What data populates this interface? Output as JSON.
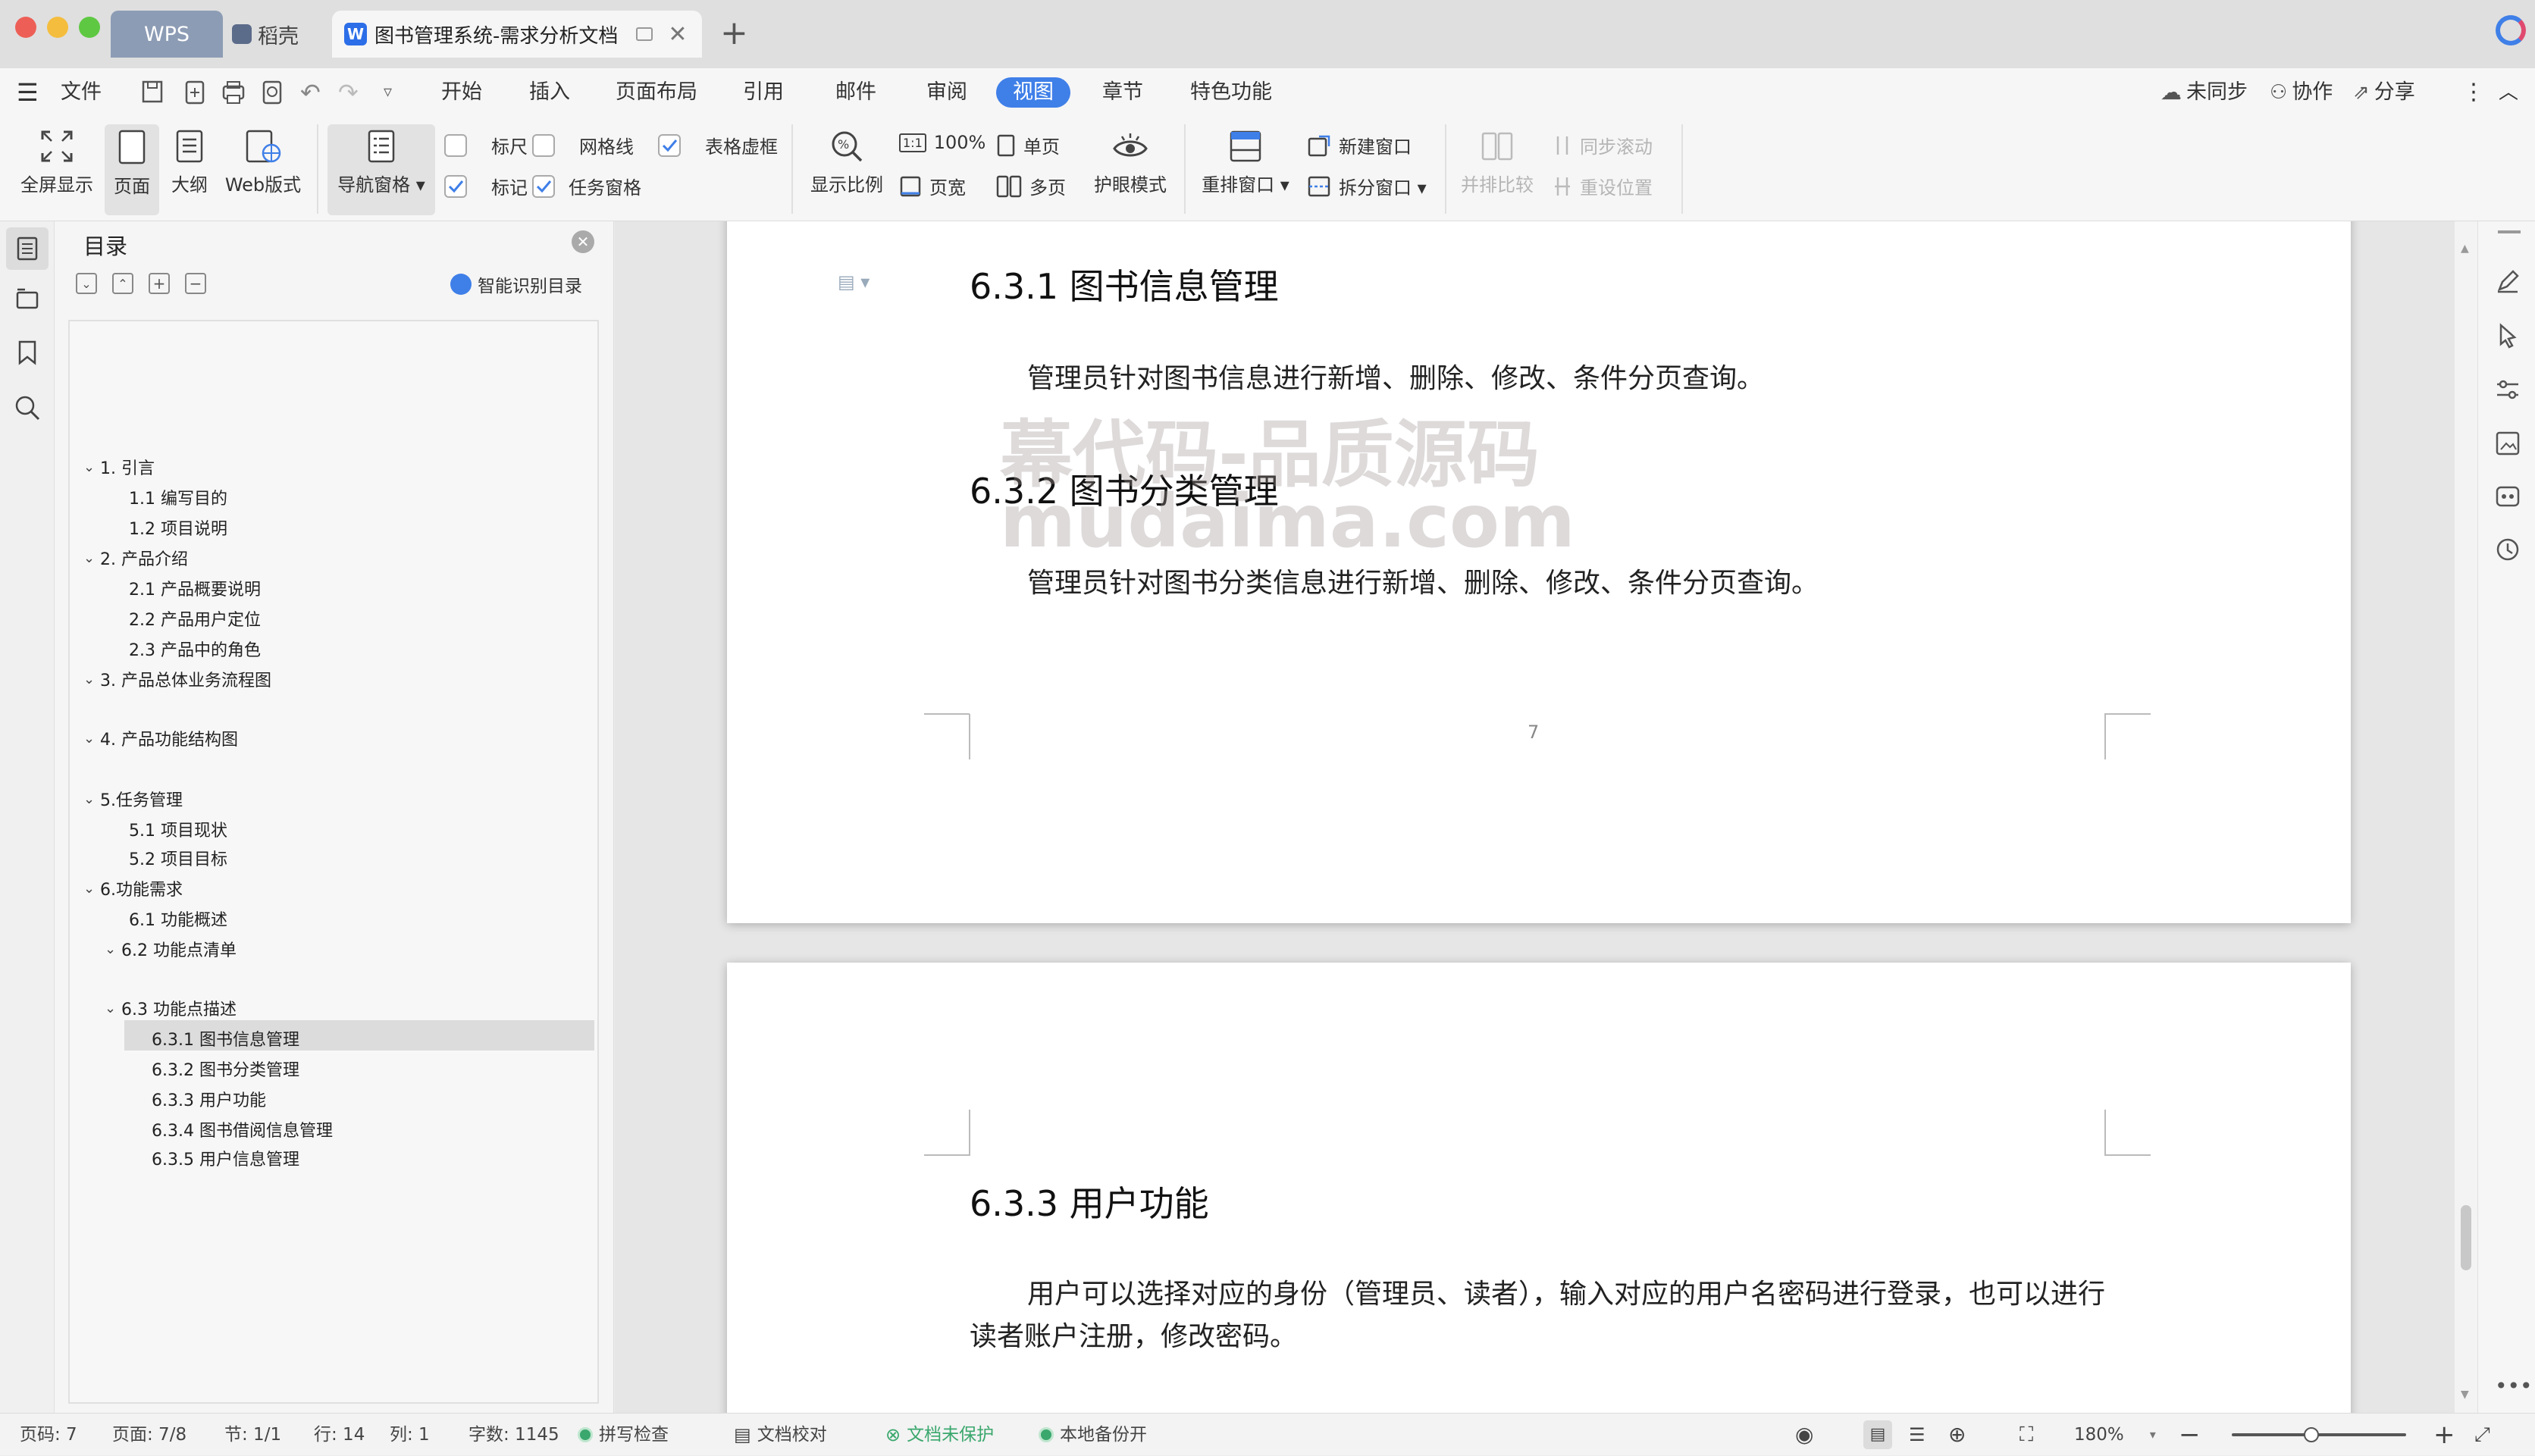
{
  "titlebar": {
    "tabs": [
      {
        "label": "WPS"
      },
      {
        "label": "稻壳"
      },
      {
        "label": "图书管理系统-需求分析文档"
      }
    ]
  },
  "menu": {
    "file": "文件",
    "items": [
      "开始",
      "插入",
      "页面布局",
      "引用",
      "邮件",
      "审阅",
      "视图",
      "章节",
      "特色功能"
    ],
    "active": "视图",
    "right": {
      "sync": "未同步",
      "collab": "协作",
      "share": "分享"
    }
  },
  "toolbar": {
    "fullscreen": "全屏显示",
    "page": "页面",
    "outline": "大纲",
    "web": "Web版式",
    "nav_pane": "导航窗格",
    "ruler": "标尺",
    "gridlines": "网格线",
    "table_frame": "表格虚框",
    "mark": "标记",
    "task_pane": "任务窗格",
    "zoom": "显示比例",
    "zoom100": "100%",
    "page_width": "页宽",
    "single_page": "单页",
    "multi_page": "多页",
    "eye_mode": "护眼模式",
    "rearrange": "重排窗口",
    "new_window": "新建窗口",
    "split_window": "拆分窗口",
    "side_by_side": "并排比较",
    "sync_scroll": "同步滚动",
    "reset_pos": "重设位置",
    "checkboxes": {
      "ruler": false,
      "gridlines": false,
      "table_frame": true,
      "mark": true,
      "task_pane": true
    }
  },
  "toc": {
    "title": "目录",
    "smart_btn": "智能识别目录",
    "items": [
      {
        "label": "1.  引言",
        "level": 1,
        "expanded": true
      },
      {
        "label": "1.1  编写目的",
        "level": 2
      },
      {
        "label": "1.2  项目说明",
        "level": 2
      },
      {
        "label": "2.  产品介绍",
        "level": 1,
        "expanded": true
      },
      {
        "label": "2.1  产品概要说明",
        "level": 2
      },
      {
        "label": "2.2  产品用户定位",
        "level": 2
      },
      {
        "label": "2.3  产品中的角色",
        "level": 2
      },
      {
        "label": "3.  产品总体业务流程图",
        "level": 1,
        "expanded": true
      },
      {
        "label": "4.  产品功能结构图",
        "level": 1,
        "expanded": true
      },
      {
        "label": "5.任务管理",
        "level": 1,
        "expanded": true
      },
      {
        "label": "5.1  项目现状",
        "level": 2
      },
      {
        "label": "5.2  项目目标",
        "level": 2
      },
      {
        "label": "6.功能需求",
        "level": 1,
        "expanded": true
      },
      {
        "label": "6.1  功能概述",
        "level": 2
      },
      {
        "label": "6.2  功能点清单",
        "level": 2,
        "expanded": true
      },
      {
        "label": "6.3  功能点描述",
        "level": 2,
        "expanded": true
      },
      {
        "label": "6.3.1  图书信息管理",
        "level": 3,
        "active": true
      },
      {
        "label": "6.3.2  图书分类管理",
        "level": 3
      },
      {
        "label": "6.3.3  用户功能",
        "level": 3
      },
      {
        "label": "6.3.4  图书借阅信息管理",
        "level": 3
      },
      {
        "label": "6.3.5  用户信息管理",
        "level": 3
      }
    ]
  },
  "document": {
    "page7": {
      "h1": "6.3.1  图书信息管理",
      "p1": "管理员针对图书信息进行新增、删除、修改、条件分页查询。",
      "h2": "6.3.2  图书分类管理",
      "p2": "管理员针对图书分类信息进行新增、删除、修改、条件分页查询。",
      "page_number": "7"
    },
    "page8": {
      "h1": "6.3.3  用户功能",
      "p1": "用户可以选择对应的身份（管理员、读者），输入对应的用户名密码进行登录，也可以进行读者账户注册，修改密码。"
    },
    "watermark": {
      "line1": "幕代码-品质源码",
      "line2": "mudaima.com"
    }
  },
  "status": {
    "page": "页码: 7",
    "pages": "页面: 7/8",
    "section": "节: 1/1",
    "row": "行: 14",
    "col": "列: 1",
    "words": "字数: 1145",
    "spell": "拼写检查",
    "proof": "文档校对",
    "unprotected": "文档未保护",
    "backup": "本地备份开",
    "zoom": "180%",
    "zoom_level": 0.45
  },
  "colors": {
    "accent": "#3f7fe8",
    "tab_wps": "#8d9cb5",
    "green": "#3aa76d"
  }
}
